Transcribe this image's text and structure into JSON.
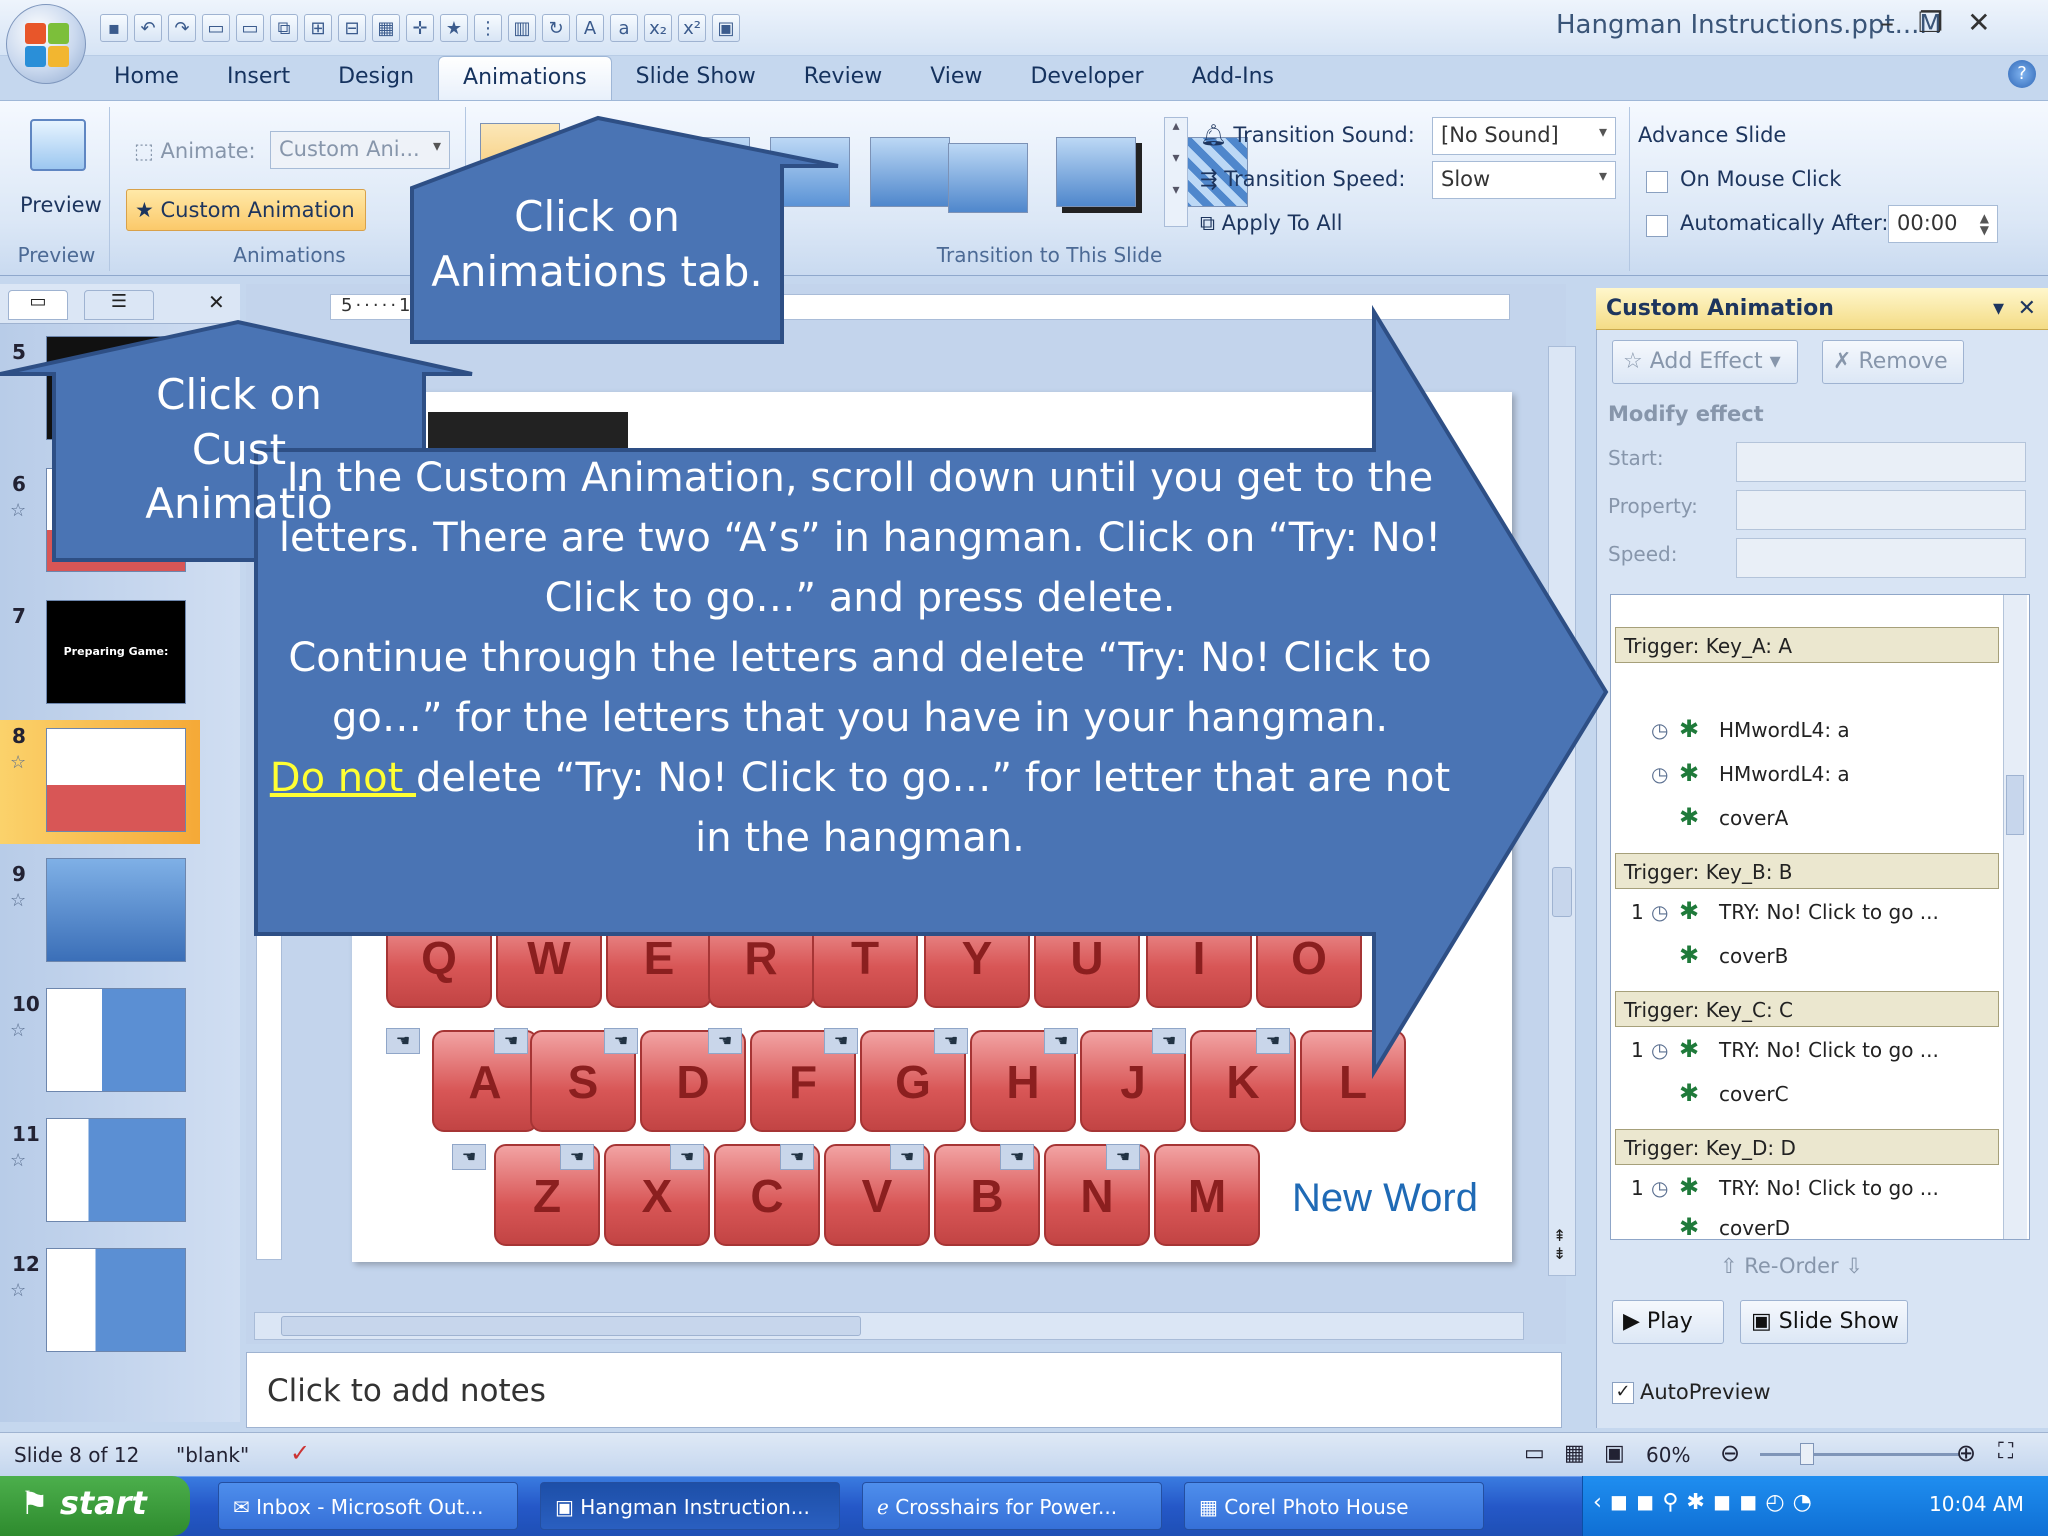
{
  "window": {
    "title": "Hangman Instructions.ppt...M",
    "controls": [
      "–",
      "❐",
      "✕"
    ]
  },
  "tabs": [
    "Home",
    "Insert",
    "Design",
    "Animations",
    "Slide Show",
    "Review",
    "View",
    "Developer",
    "Add-Ins"
  ],
  "active_tab": "Animations",
  "ribbon": {
    "preview": {
      "button": "Preview",
      "group": "Preview"
    },
    "animations": {
      "animate_label": "Animate:",
      "animate_value": "Custom Ani...",
      "custom_animation_button": "Custom Animation",
      "group": "Animations"
    },
    "transition": {
      "sound_label": "Transition Sound:",
      "sound_value": "[No Sound]",
      "speed_label": "Transition Speed:",
      "speed_value": "Slow",
      "apply_all": "Apply To All",
      "group": "Transition to This Slide"
    },
    "advance": {
      "title": "Advance Slide",
      "on_mouse_click": "On Mouse Click",
      "automatically_after": "Automatically After:",
      "time": "00:00"
    }
  },
  "ruler_text": "5·····1·····0·····1·····2·····3·····4·····",
  "slides": [
    {
      "num": "5",
      "thumb": ""
    },
    {
      "num": "6",
      "thumb": ""
    },
    {
      "num": "7",
      "thumb": "Preparing Game:"
    },
    {
      "num": "8",
      "thumb": ""
    },
    {
      "num": "9",
      "thumb": ""
    },
    {
      "num": "10",
      "thumb": ""
    },
    {
      "num": "11",
      "thumb": ""
    },
    {
      "num": "12",
      "thumb": ""
    }
  ],
  "keyboard": {
    "row1": [
      "Q",
      "W",
      "E",
      "R",
      "T",
      "Y",
      "U",
      "I",
      "O"
    ],
    "row2": [
      "A",
      "S",
      "D",
      "F",
      "G",
      "H",
      "J",
      "K",
      "L"
    ],
    "row3": [
      "Z",
      "X",
      "C",
      "V",
      "B",
      "N",
      "M"
    ],
    "new_word": "New Word"
  },
  "notes_placeholder": "Click to add notes",
  "custom_animation": {
    "title": "Custom Animation",
    "add_effect": "Add Effect",
    "remove": "Remove",
    "modify_effect": "Modify effect",
    "start_label": "Start:",
    "property_label": "Property:",
    "speed_label": "Speed:",
    "list": [
      {
        "trigger": "Trigger: Key_A: A",
        "items": [
          {
            "num": "",
            "name": "HMwordL4: a"
          },
          {
            "num": "",
            "name": "HMwordL4: a"
          },
          {
            "num": "",
            "name": "coverA"
          }
        ]
      },
      {
        "trigger": "Trigger: Key_B: B",
        "items": [
          {
            "num": "1",
            "name": "TRY: No! Click to go ..."
          },
          {
            "num": "",
            "name": "coverB"
          }
        ]
      },
      {
        "trigger": "Trigger: Key_C: C",
        "items": [
          {
            "num": "1",
            "name": "TRY: No! Click to go ..."
          },
          {
            "num": "",
            "name": "coverC"
          }
        ]
      },
      {
        "trigger": "Trigger: Key_D: D",
        "items": [
          {
            "num": "1",
            "name": "TRY: No! Click to go ..."
          },
          {
            "num": "",
            "name": "coverD"
          }
        ]
      }
    ],
    "reorder": "Re-Order",
    "play": "Play",
    "slide_show": "Slide Show",
    "autopreview": "AutoPreview"
  },
  "status": {
    "slide": "Slide 8 of 12",
    "theme": "\"blank\"",
    "zoom": "60%"
  },
  "taskbar": {
    "start": "start",
    "tasks": [
      "Inbox - Microsoft Out...",
      "Hangman Instruction...",
      "Crosshairs for Power...",
      "Corel Photo House"
    ],
    "time": "10:04 AM"
  },
  "callouts": {
    "animations_tab": "Click on Animations tab.",
    "custom_anim_line1": "Click on",
    "custom_anim_line2": "Cust",
    "custom_anim_line3": "Animatio",
    "main_1": "In the Custom Animation, scroll down until you get to the letters.  There are two “A’s” in hangman.  Click on “Try: No! Click to go…” and press delete.",
    "main_2": "Continue through the letters and delete “Try: No! Click to go…”  for the letters that you have in your hangman.",
    "main_3_highlight": "Do not ",
    "main_3_rest": "delete “Try: No! Click to go…”  for letter that are not in the hangman."
  },
  "colors": {
    "callout_fill": "#4a74b4",
    "callout_stroke": "#2e4f85",
    "highlight": "#ffff33"
  }
}
